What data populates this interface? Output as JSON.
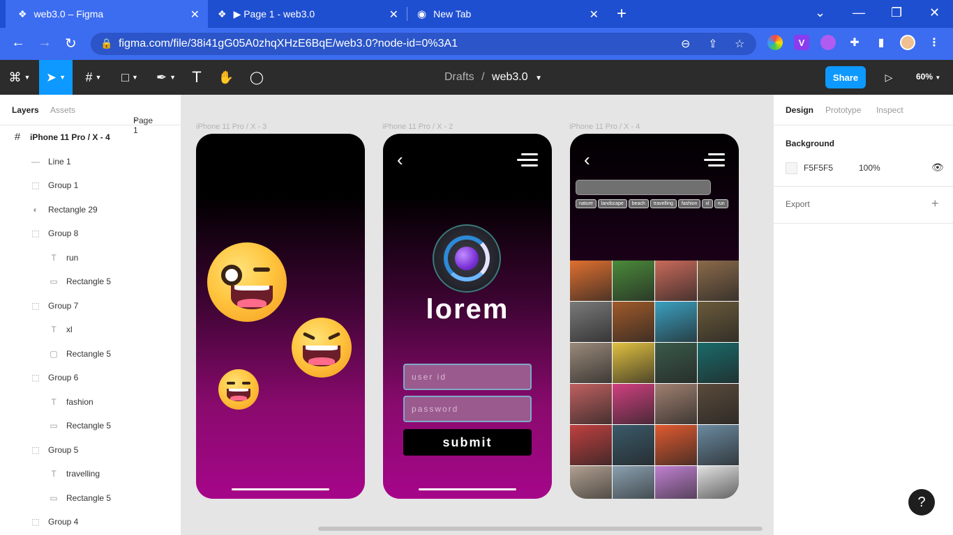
{
  "browser": {
    "tabs": [
      {
        "title": "web3.0 – Figma",
        "active": true
      },
      {
        "title": "▶ Page 1 - web3.0",
        "active": false
      },
      {
        "title": "New Tab",
        "active": false
      }
    ],
    "url": "figma.com/file/38i41gG05A0zhqXHzE6BqE/web3.0?node-id=0%3A1"
  },
  "toolbar": {
    "breadcrumb_parent": "Drafts",
    "breadcrumb_sep": "/",
    "file_name": "web3.0",
    "share_label": "Share",
    "zoom": "60%"
  },
  "left_panel": {
    "tab_layers": "Layers",
    "tab_assets": "Assets",
    "page": "Page 1",
    "layers": [
      {
        "name": "iPhone 11 Pro / X - 4",
        "icon": "frame-icon",
        "glyph": "#",
        "level": 0
      },
      {
        "name": "Line 1",
        "icon": "line-icon",
        "glyph": "—",
        "level": 1
      },
      {
        "name": "Group 1",
        "icon": "group-icon",
        "glyph": "⬚",
        "level": 1
      },
      {
        "name": "Rectangle 29",
        "icon": "mask-icon",
        "glyph": "◐",
        "level": 1
      },
      {
        "name": "Group 8",
        "icon": "group-icon",
        "glyph": "⬚",
        "level": 1
      },
      {
        "name": "run",
        "icon": "text-icon",
        "glyph": "T",
        "level": 2
      },
      {
        "name": "Rectangle 5",
        "icon": "rectangle-icon",
        "glyph": "▭",
        "level": 2
      },
      {
        "name": "Group 7",
        "icon": "group-icon",
        "glyph": "⬚",
        "level": 1
      },
      {
        "name": "xl",
        "icon": "text-icon",
        "glyph": "T",
        "level": 2
      },
      {
        "name": "Rectangle 5",
        "icon": "rectangle-icon",
        "glyph": "▢",
        "level": 2
      },
      {
        "name": "Group 6",
        "icon": "group-icon",
        "glyph": "⬚",
        "level": 1
      },
      {
        "name": "fashion",
        "icon": "text-icon",
        "glyph": "T",
        "level": 2
      },
      {
        "name": "Rectangle 5",
        "icon": "rectangle-icon",
        "glyph": "▭",
        "level": 2
      },
      {
        "name": "Group 5",
        "icon": "group-icon",
        "glyph": "⬚",
        "level": 1
      },
      {
        "name": "travelling",
        "icon": "text-icon",
        "glyph": "T",
        "level": 2
      },
      {
        "name": "Rectangle 5",
        "icon": "rectangle-icon",
        "glyph": "▭",
        "level": 2
      },
      {
        "name": "Group 4",
        "icon": "group-icon",
        "glyph": "⬚",
        "level": 1
      }
    ]
  },
  "canvas": {
    "frames": [
      {
        "label": "iPhone 11 Pro / X - 3"
      },
      {
        "label": "iPhone 11 Pro / X - 2"
      },
      {
        "label": "iPhone 11 Pro / X - 4"
      }
    ],
    "login": {
      "brand": "lorem",
      "user_placeholder": "user id",
      "password_placeholder": "password",
      "submit": "submit"
    },
    "gallery": {
      "chips": [
        "nature",
        "landscape",
        "beach",
        "travelling",
        "fashion",
        "xl",
        "run"
      ],
      "photo_colors": [
        "#e07030",
        "#4a8a3a",
        "#c86a5a",
        "#8a6a4a",
        "#7a7a7a",
        "#a05a2a",
        "#3aa0c0",
        "#6a5a3a",
        "#9a8a7a",
        "#e0c040",
        "#3a5a4a",
        "#1a6a6a",
        "#c06060",
        "#d04080",
        "#a08070",
        "#5a4a3a",
        "#c04040",
        "#3a5a6a",
        "#e05a30",
        "#6a8aa0",
        "#b0a090",
        "#8aa0b0",
        "#c080d0",
        "#e0e0e0"
      ]
    }
  },
  "right_panel": {
    "tab_design": "Design",
    "tab_prototype": "Prototype",
    "tab_inspect": "Inspect",
    "background_title": "Background",
    "bg_hex": "F5F5F5",
    "bg_opacity": "100%",
    "export_title": "Export",
    "export_add": "+"
  },
  "help": "?"
}
